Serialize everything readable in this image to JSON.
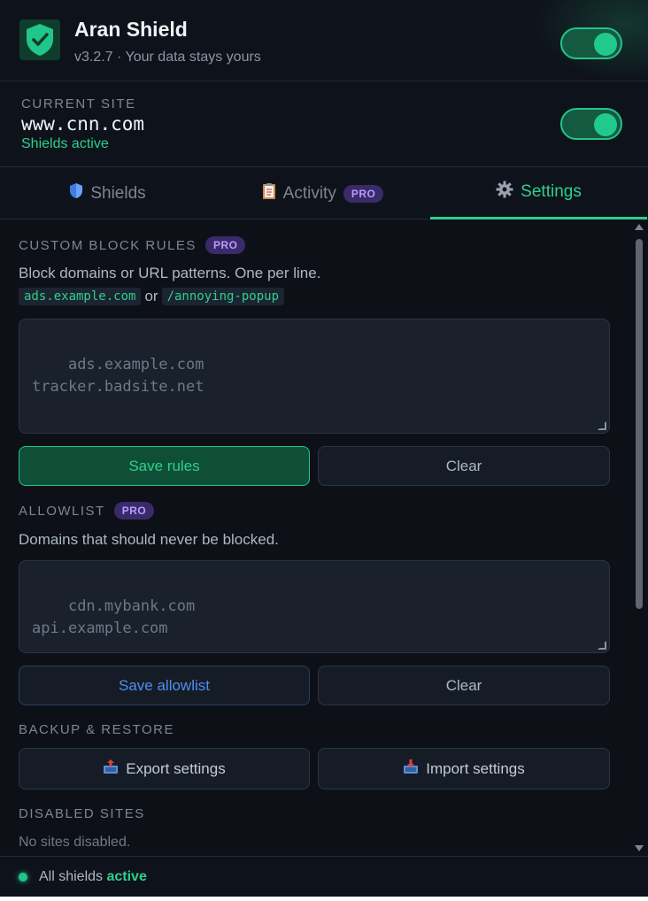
{
  "header": {
    "title": "Aran Shield",
    "subtitle": "v3.2.7 · Your data stays yours",
    "logo_icon": "shield-check-icon",
    "master_toggle_on": true
  },
  "site": {
    "label": "CURRENT SITE",
    "domain": "www.cnn.com",
    "status": "Shields active",
    "toggle_on": true
  },
  "tabs": [
    {
      "label": "Shields",
      "icon": "shield-icon",
      "active": false
    },
    {
      "label": "Activity",
      "icon": "clipboard-icon",
      "badge": "PRO",
      "active": false
    },
    {
      "label": "Settings",
      "icon": "gear-icon",
      "active": true
    }
  ],
  "custom_rules": {
    "title": "CUSTOM BLOCK RULES",
    "badge": "PRO",
    "description": "Block domains or URL patterns. One per line.",
    "example1": "ads.example.com",
    "or": "or",
    "example2": "/annoying-popup",
    "placeholder": "ads.example.com\ntracker.badsite.net",
    "save_label": "Save rules",
    "clear_label": "Clear"
  },
  "allowlist": {
    "title": "ALLOWLIST",
    "badge": "PRO",
    "description": "Domains that should never be blocked.",
    "placeholder": "cdn.mybank.com\napi.example.com",
    "save_label": "Save allowlist",
    "clear_label": "Clear"
  },
  "backup": {
    "title": "BACKUP & RESTORE",
    "export_label": "Export settings",
    "import_label": "Import settings",
    "export_icon": "outbox-tray-icon",
    "import_icon": "inbox-tray-icon"
  },
  "disabled_sites": {
    "title": "DISABLED SITES",
    "empty_text": "No sites disabled."
  },
  "footer": {
    "prefix": "All shields",
    "state": "active"
  },
  "colors": {
    "accent": "#2fcf8d",
    "pro_badge": "#b69cff",
    "background": "#0d1117"
  }
}
